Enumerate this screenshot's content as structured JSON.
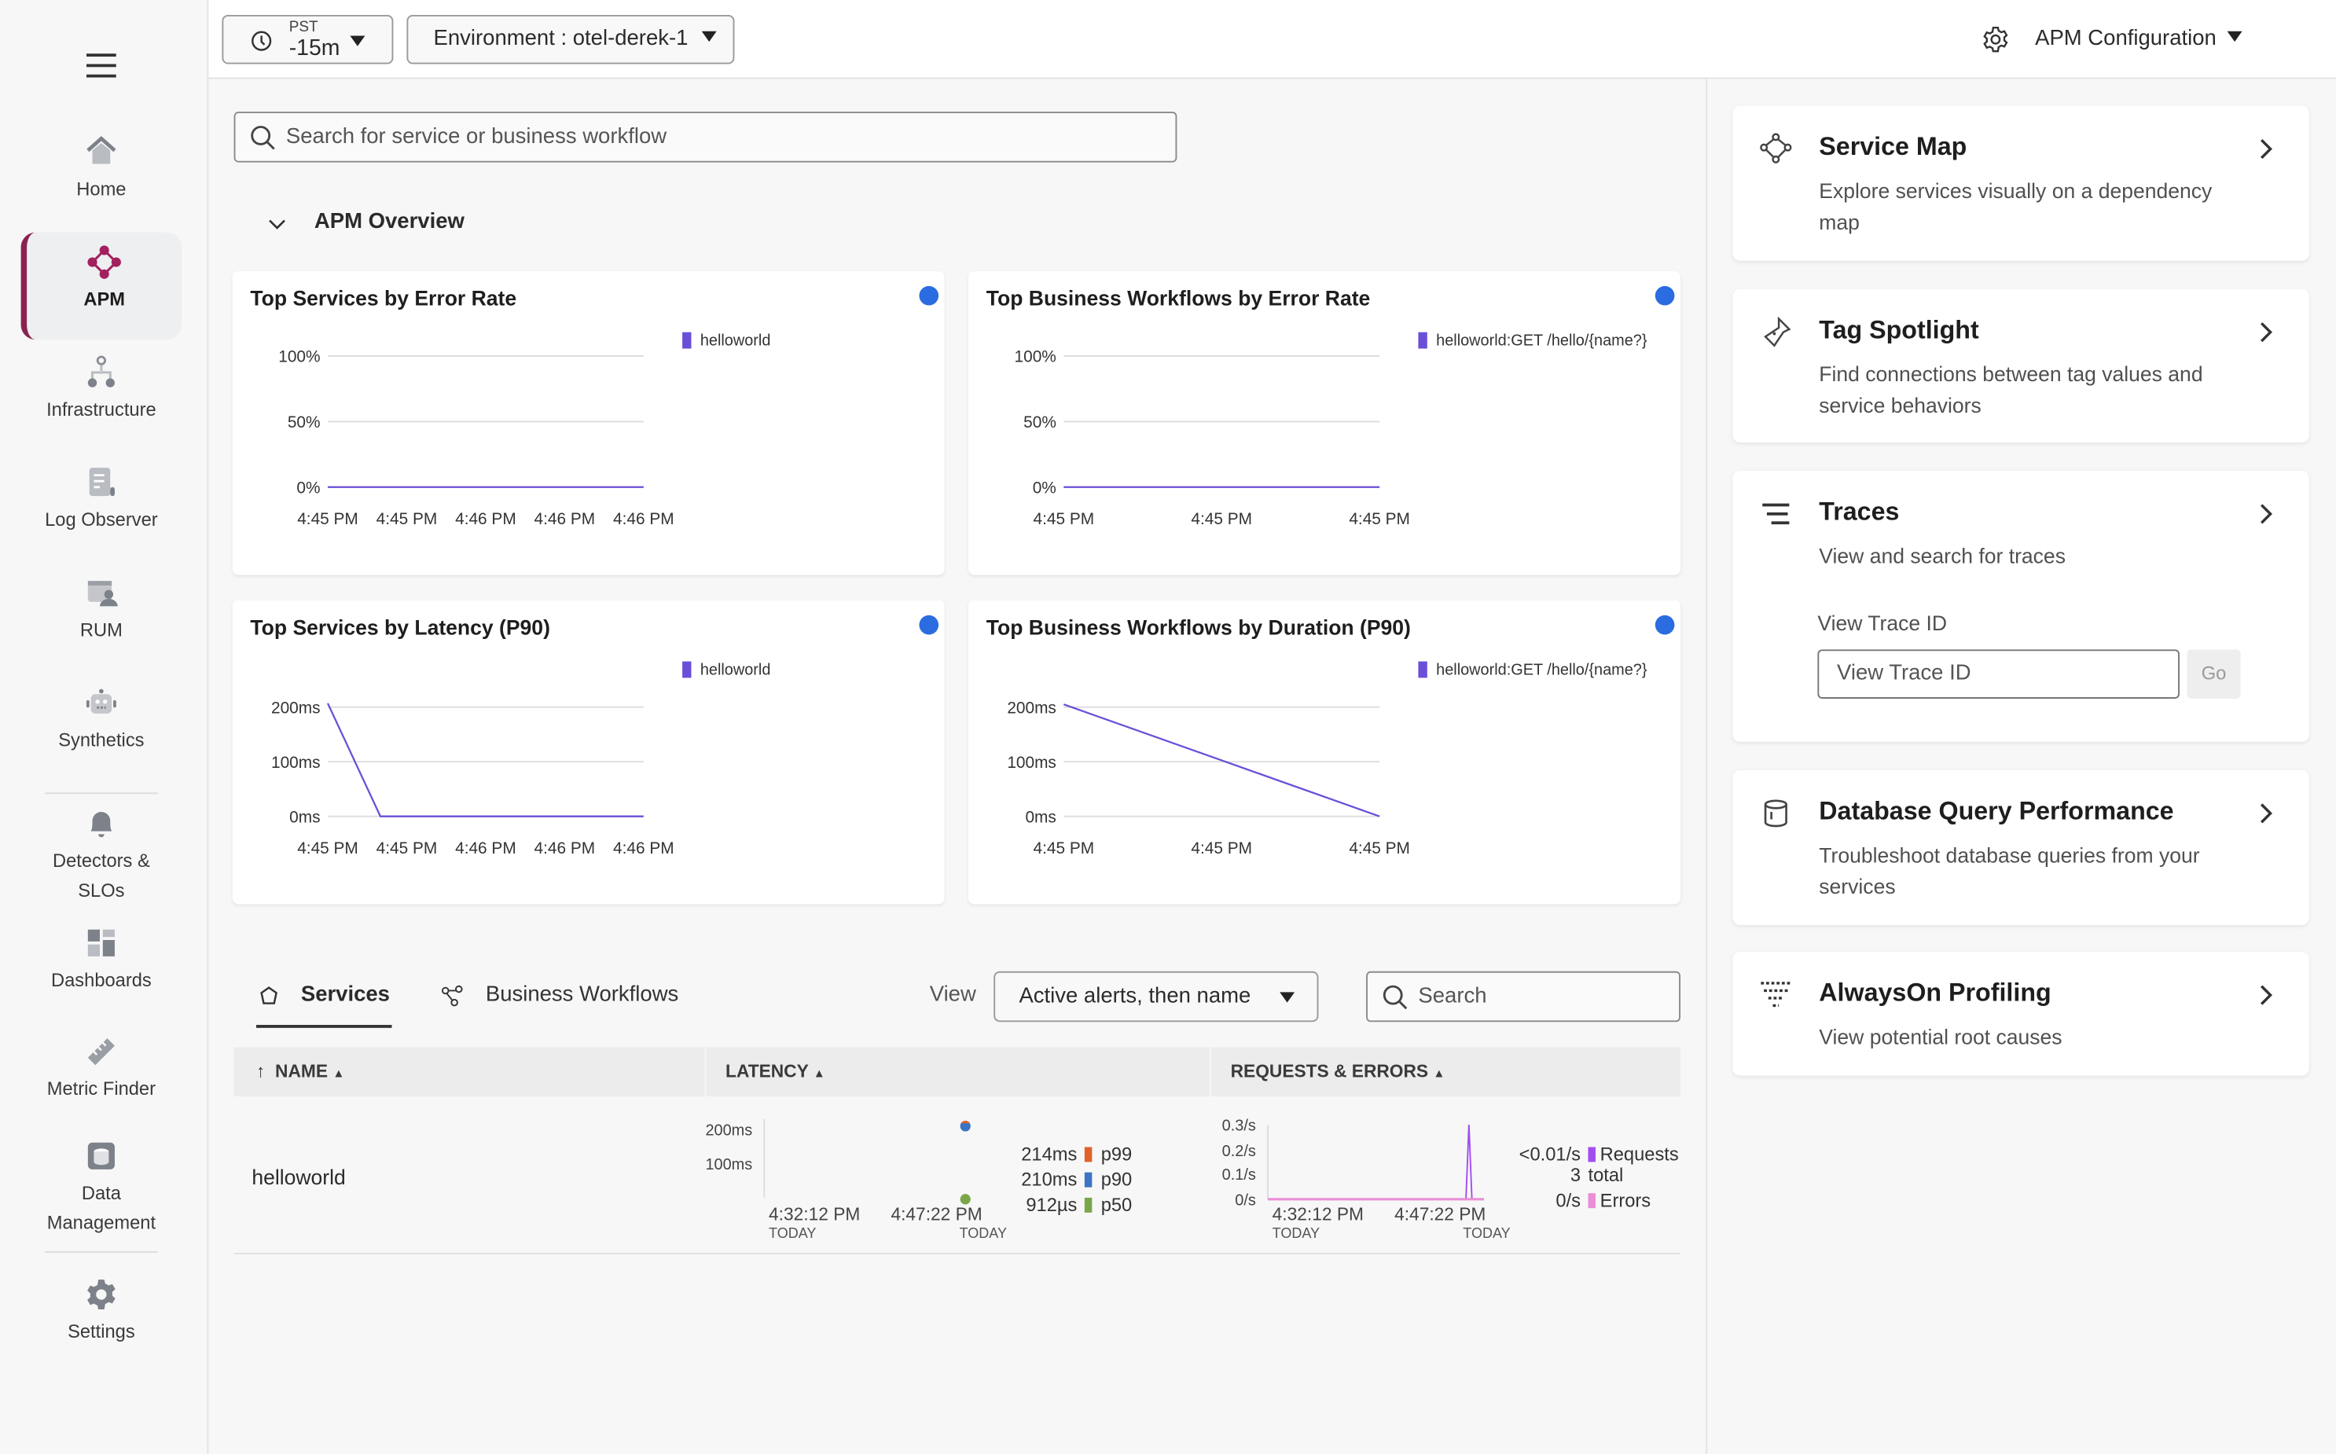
{
  "sidebar": {
    "menu_icon": "hamburger-icon",
    "items": [
      {
        "label": "Home",
        "icon": "home-icon"
      },
      {
        "label": "APM",
        "icon": "apm-icon",
        "active": true
      },
      {
        "label": "Infrastructure",
        "icon": "infrastructure-icon"
      },
      {
        "label": "Log Observer",
        "icon": "log-icon"
      },
      {
        "label": "RUM",
        "icon": "rum-icon"
      },
      {
        "label": "Synthetics",
        "icon": "robot-icon"
      },
      {
        "label": "Detectors &",
        "label2": "SLOs",
        "icon": "bell-icon"
      },
      {
        "label": "Dashboards",
        "icon": "dashboard-icon"
      },
      {
        "label": "Metric Finder",
        "icon": "ruler-icon"
      },
      {
        "label": "Data",
        "label2": "Management",
        "icon": "database-icon"
      },
      {
        "label": "Settings",
        "icon": "gear-icon"
      }
    ],
    "accent": "#8a2252"
  },
  "topbar": {
    "timezone": "PST",
    "time_range": "-15m",
    "environment": "Environment : otel-derek-1",
    "config_label": "APM Configuration"
  },
  "main": {
    "search_placeholder": "Search for service or business workflow",
    "section_title": "APM Overview"
  },
  "chart_data": [
    {
      "type": "line",
      "title": "Top Services by Error Rate",
      "xticks": [
        "4:45 PM",
        "4:45 PM",
        "4:46 PM",
        "4:46 PM",
        "4:46 PM"
      ],
      "yticks": [
        "0%",
        "50%",
        "100%"
      ],
      "ytick_values": [
        0,
        50,
        100
      ],
      "ylim": [
        0,
        100
      ],
      "series": [
        {
          "name": "helloworld",
          "values": [
            0,
            0,
            0,
            0,
            0,
            0,
            0
          ],
          "color": "#6b4fd8"
        }
      ]
    },
    {
      "type": "line",
      "title": "Top Business Workflows by Error Rate",
      "xticks": [
        "4:45 PM",
        "4:45 PM",
        "4:45 PM"
      ],
      "yticks": [
        "0%",
        "50%",
        "100%"
      ],
      "ytick_values": [
        0,
        50,
        100
      ],
      "ylim": [
        0,
        100
      ],
      "series": [
        {
          "name": "helloworld:GET /hello/{name?}",
          "values": [
            0,
            0
          ],
          "color": "#6b4fd8"
        }
      ]
    },
    {
      "type": "line",
      "title": "Top Services by Latency (P90)",
      "xticks": [
        "4:45 PM",
        "4:45 PM",
        "4:46 PM",
        "4:46 PM",
        "4:46 PM"
      ],
      "yticks": [
        "0ms",
        "100ms",
        "200ms"
      ],
      "ytick_values": [
        0,
        100,
        200
      ],
      "ylim": [
        0,
        240
      ],
      "series": [
        {
          "name": "helloworld",
          "values": [
            207,
            0,
            0,
            0,
            0,
            0,
            0
          ],
          "color": "#6b4fd8"
        }
      ]
    },
    {
      "type": "line",
      "title": "Top Business Workflows by Duration (P90)",
      "xticks": [
        "4:45 PM",
        "4:45 PM",
        "4:45 PM"
      ],
      "yticks": [
        "0ms",
        "100ms",
        "200ms"
      ],
      "ytick_values": [
        0,
        100,
        200
      ],
      "ylim": [
        0,
        240
      ],
      "series": [
        {
          "name": "helloworld:GET /hello/{name?}",
          "values": [
            205,
            0
          ],
          "color": "#6b4fd8"
        }
      ]
    }
  ],
  "tabs": [
    {
      "label": "Services",
      "active": true
    },
    {
      "label": "Business Workflows"
    }
  ],
  "view": {
    "label": "View",
    "selected": "Active alerts, then name",
    "search_placeholder": "Search"
  },
  "table": {
    "columns": [
      "NAME",
      "LATENCY",
      "REQUESTS & ERRORS"
    ],
    "rows": [
      {
        "name": "helloworld",
        "latency": {
          "yticks": [
            "200ms",
            "100ms"
          ],
          "xticks": [
            "4:32:12 PM",
            "4:47:22 PM"
          ],
          "xsub": [
            "TODAY",
            "TODAY"
          ],
          "legend": [
            {
              "value": "214ms",
              "label": "p99",
              "color": "#e0622a"
            },
            {
              "value": "210ms",
              "label": "p90",
              "color": "#3d74c4"
            },
            {
              "value": "912µs",
              "label": "p50",
              "color": "#7aa64a"
            }
          ]
        },
        "requests": {
          "yticks": [
            "0.3/s",
            "0.2/s",
            "0.1/s",
            "0/s"
          ],
          "xticks": [
            "4:32:12 PM",
            "4:47:22 PM"
          ],
          "xsub": [
            "TODAY",
            "TODAY"
          ],
          "req_value": "<0.01/s",
          "req_label": "Requests",
          "total": "3",
          "total_label": "total",
          "err_value": "0/s",
          "err_label": "Errors",
          "req_color": "#a24cf0",
          "err_color": "#ea8ed6",
          "peak": 0.3
        }
      }
    ]
  },
  "right": {
    "cards": [
      {
        "title": "Service Map",
        "desc": "Explore services visually on a dependency map",
        "icon": "service-map-icon"
      },
      {
        "title": "Tag Spotlight",
        "desc": "Find connections between tag values and service behaviors",
        "icon": "flashlight-icon"
      },
      {
        "title": "Traces",
        "desc": "View and search for traces",
        "icon": "traces-icon",
        "field_label": "View Trace ID",
        "placeholder": "View Trace ID",
        "go": "Go"
      },
      {
        "title": "Database Query Performance",
        "desc": "Troubleshoot database queries from your services",
        "icon": "database-icon"
      },
      {
        "title": "AlwaysOn Profiling",
        "desc": "View potential root causes",
        "icon": "profiling-icon"
      }
    ]
  }
}
